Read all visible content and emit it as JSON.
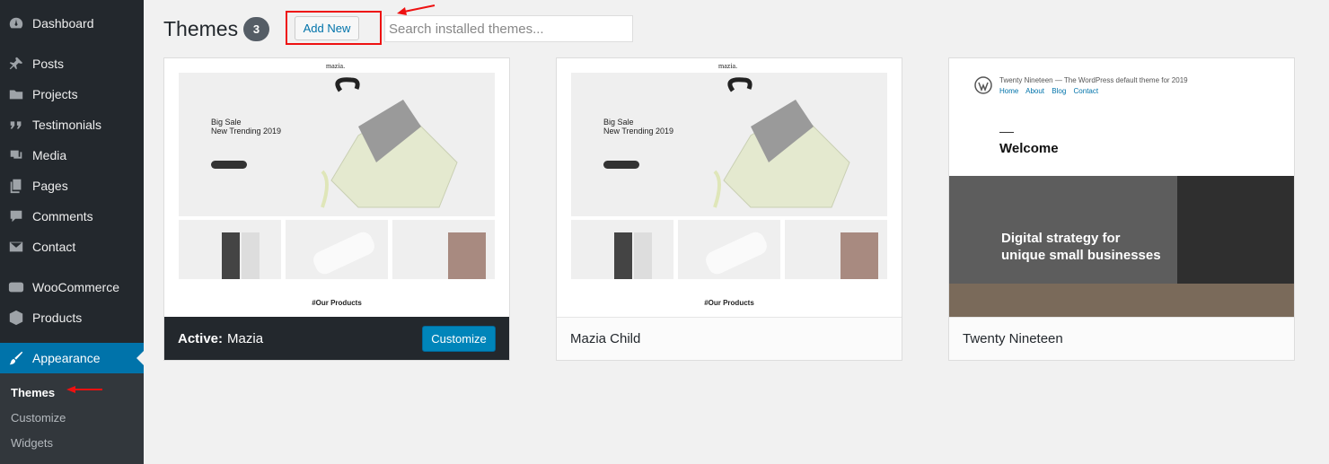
{
  "sidebar": {
    "items": [
      {
        "label": "Dashboard",
        "icon": "dashboard-icon"
      },
      {
        "label": "Posts",
        "icon": "pin-icon"
      },
      {
        "label": "Projects",
        "icon": "folder-icon"
      },
      {
        "label": "Testimonials",
        "icon": "quote-icon"
      },
      {
        "label": "Media",
        "icon": "media-icon"
      },
      {
        "label": "Pages",
        "icon": "pages-icon"
      },
      {
        "label": "Comments",
        "icon": "comment-icon"
      },
      {
        "label": "Contact",
        "icon": "mail-icon"
      },
      {
        "label": "WooCommerce",
        "icon": "woo-icon"
      },
      {
        "label": "Products",
        "icon": "box-icon"
      },
      {
        "label": "Appearance",
        "icon": "brush-icon"
      }
    ],
    "submenu": [
      {
        "label": "Themes"
      },
      {
        "label": "Customize"
      },
      {
        "label": "Widgets"
      }
    ]
  },
  "header": {
    "title": "Themes",
    "count": "3",
    "add_new_label": "Add New",
    "search_placeholder": "Search installed themes..."
  },
  "themes": [
    {
      "active_prefix": "Active:",
      "name": "Mazia",
      "customize_label": "Customize",
      "preview": {
        "logo": "mazia.",
        "hero_line1": "Big Sale",
        "hero_line2": "New Trending 2019",
        "products_heading": "#Our Products"
      }
    },
    {
      "name": "Mazia Child",
      "preview": {
        "logo": "mazia.",
        "hero_line1": "Big Sale",
        "hero_line2": "New Trending 2019",
        "products_heading": "#Our Products"
      }
    },
    {
      "name": "Twenty Nineteen",
      "preview": {
        "site_title": "Twenty Nineteen — The WordPress default theme for 2019",
        "links": [
          "Home",
          "About",
          "Blog",
          "Contact"
        ],
        "welcome": "Welcome",
        "hero_line1": "Digital strategy for",
        "hero_line2": "unique small businesses"
      }
    }
  ],
  "colors": {
    "sidebar_bg": "#23282d",
    "accent": "#0073aa",
    "highlight_red": "#e11111"
  }
}
